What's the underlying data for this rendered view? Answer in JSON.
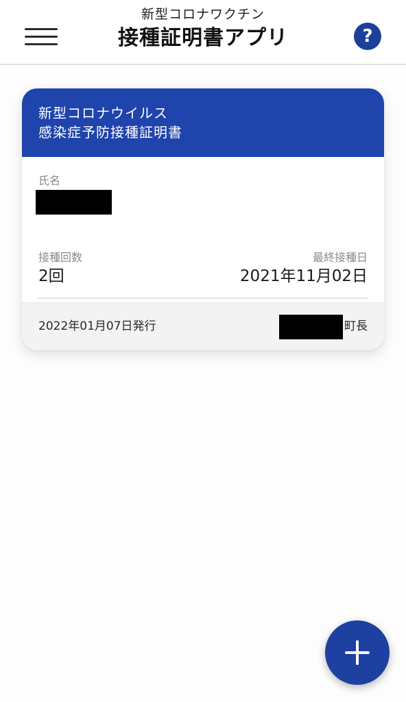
{
  "header": {
    "subtitle": "新型コロナワクチン",
    "title": "接種証明書アプリ",
    "menu_icon": "hamburger-menu-icon",
    "help_icon": "question-mark-icon",
    "help_glyph": "?"
  },
  "certificate": {
    "heading_line1": "新型コロナウイルス",
    "heading_line2": "感染症予防接種証明書",
    "name_label": "氏名",
    "name_value_redacted": true,
    "dose_count_label": "接種回数",
    "dose_count_value": "2回",
    "last_dose_label": "最終接種日",
    "last_dose_value": "2021年11月02日",
    "issue_date": "2022年01月07日発行",
    "issuer_suffix": "町長",
    "issuer_name_redacted": true
  },
  "fab": {
    "icon": "plus-icon"
  },
  "colors": {
    "brand_blue": "#1f44ac",
    "help_blue": "#1d3f99",
    "fab_blue": "#1e40a0"
  }
}
